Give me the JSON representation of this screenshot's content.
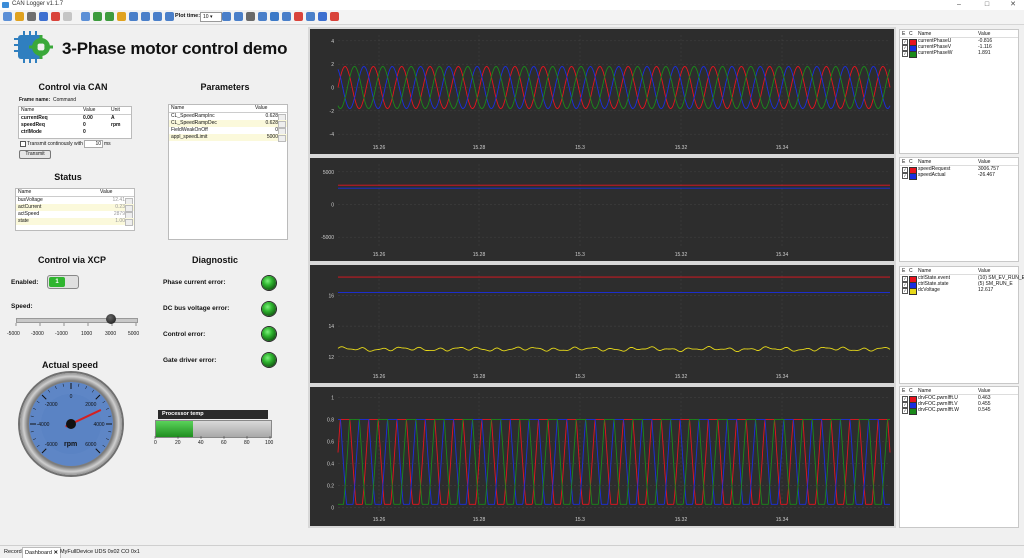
{
  "window": {
    "title": "CAN Logger v1.1.7",
    "minimize": "–",
    "maximize": "□",
    "close": "✕"
  },
  "toolbar": {
    "plot_time_label": "Plot time:",
    "plot_time_value": "10",
    "icons_group1": [
      "new-file-icon",
      "open-folder-icon",
      "open-icon",
      "save-icon",
      "stop-icon",
      "clear-icon"
    ],
    "icons_group2": [
      "grid-icon",
      "chart-icon",
      "trend-icon",
      "warning-icon",
      "zoom-in-icon",
      "zoom-out-icon",
      "zoom-fit-icon",
      "zoom-area-icon"
    ],
    "icons_group3": [
      "export-icon",
      "copy-icon",
      "print-icon",
      "filter-icon",
      "pen-icon",
      "measure-icon",
      "scale-icon",
      "info-icon",
      "close-circle-icon",
      "eject-icon"
    ]
  },
  "dashboard": {
    "title": "3-Phase motor control demo",
    "control_can": {
      "title": "Control via CAN",
      "frame_name_label": "Frame name:",
      "frame_name_value": "Command",
      "headers": [
        "Name",
        "Value",
        "Unit"
      ],
      "rows": [
        {
          "name": "currentReq",
          "value": "0.00",
          "unit": "A"
        },
        {
          "name": "speedReq",
          "value": "0",
          "unit": "rpm"
        },
        {
          "name": "ctrlMode",
          "value": "0",
          "unit": ""
        }
      ],
      "transmit_checkbox_label": "Transmit continously with",
      "transmit_period": "10",
      "transmit_unit": "ms",
      "transmit_button": "Transmit"
    },
    "parameters": {
      "title": "Parameters",
      "headers": [
        "Name",
        "Value"
      ],
      "rows": [
        {
          "name": "CL_SpeedRampInc",
          "value": "0.628"
        },
        {
          "name": "CL_SpeedRampDec",
          "value": "0.628"
        },
        {
          "name": "FieldWeakOnOff",
          "value": "0"
        },
        {
          "name": "appl_speedLimit",
          "value": "5000"
        }
      ]
    },
    "status": {
      "title": "Status",
      "headers": [
        "Name",
        "Value"
      ],
      "rows": [
        {
          "name": "busVoltage",
          "value": "12.41"
        },
        {
          "name": "actCurrent",
          "value": "0.23"
        },
        {
          "name": "actSpeed",
          "value": "2879"
        },
        {
          "name": "state",
          "value": "1.00"
        }
      ]
    },
    "control_xcp": {
      "title": "Control via XCP",
      "enabled_label": "Enabled:",
      "enabled_value": "1",
      "speed_label": "Speed:",
      "slider_value": 2879,
      "slider_min": -5000,
      "slider_max": 5000,
      "scale_labels": [
        "-5000",
        "-3000",
        "-1000",
        "1000",
        "3000",
        "5000"
      ]
    },
    "diagnostic": {
      "title": "Diagnostic",
      "items": [
        "Phase current error:",
        "DC bus voltage error:",
        "Control error:",
        "Gate driver error:"
      ]
    },
    "actual_speed": {
      "title": "Actual speed",
      "unit": "rpm",
      "value": 2879,
      "min": -6000,
      "max": 6000,
      "labels": [
        "-6000",
        "-4000",
        "-2000",
        "0",
        "2000",
        "4000",
        "6000"
      ]
    },
    "processor_temp": {
      "title": "Processor temp",
      "value": 32,
      "labels": [
        "0",
        "20",
        "40",
        "60",
        "80",
        "100"
      ]
    }
  },
  "plots": [
    {
      "x_ticks": [
        "15.26",
        "15.28",
        "15.3",
        "15.32",
        "15.34"
      ],
      "y_ticks": [
        "4",
        "2",
        "0",
        "-2",
        "-4"
      ],
      "legend_headers": [
        "E",
        "C",
        "Name",
        "Value"
      ],
      "signals": [
        {
          "name": "currentPhaseU",
          "value": "-0.816",
          "color": "#e8141e"
        },
        {
          "name": "currentPhaseV",
          "value": "-1.116",
          "color": "#1a2ee0"
        },
        {
          "name": "currentPhaseW",
          "value": "1.891",
          "color": "#1a8a1a"
        }
      ]
    },
    {
      "x_ticks": [
        "15.26",
        "15.28",
        "15.3",
        "15.32",
        "15.34"
      ],
      "y_ticks": [
        "5000",
        "0",
        "-5000"
      ],
      "legend_headers": [
        "E",
        "C",
        "Name",
        "Value"
      ],
      "signals": [
        {
          "name": "speedRequest",
          "value": "3006.757",
          "color": "#e8141e"
        },
        {
          "name": "speedActual",
          "value": "-26.467",
          "color": "#1a2ee0"
        }
      ]
    },
    {
      "x_ticks": [
        "15.26",
        "15.28",
        "15.3",
        "15.32",
        "15.34"
      ],
      "y_ticks": [
        "16",
        "14",
        "12"
      ],
      "legend_headers": [
        "E",
        "C",
        "Name",
        "Value"
      ],
      "signals": [
        {
          "name": "ctrlState.event",
          "value": "(10) SM_EV_RUN_E",
          "color": "#e8141e"
        },
        {
          "name": "ctrlState.state",
          "value": "(5) SM_RUN_E",
          "color": "#1a2ee0"
        },
        {
          "name": "dcVoltage",
          "value": "12.617",
          "color": "#e6d81a"
        }
      ]
    },
    {
      "x_ticks": [
        "15.26",
        "15.28",
        "15.3",
        "15.32",
        "15.34"
      ],
      "y_ticks": [
        "1",
        "0.8",
        "0.6",
        "0.4",
        "0.2",
        "0"
      ],
      "legend_headers": [
        "E",
        "C",
        "Name",
        "Value"
      ],
      "signals": [
        {
          "name": "drvFOC.pwmIfft.U",
          "value": "0.463",
          "color": "#e8141e"
        },
        {
          "name": "drvFOC.pwmIfft.V",
          "value": "0.455",
          "color": "#1a2ee0"
        },
        {
          "name": "drvFOC.pwmIfft.W",
          "value": "0.545",
          "color": "#1a8a1a"
        }
      ]
    }
  ],
  "bottom_tabs": [
    "Record",
    "Dashboard",
    "MyFullDevice UDS 0x02 CO 0x1"
  ],
  "colors": {
    "accent_green": "#2fb52f",
    "plot_bg": "#2d2d2d",
    "table_alt": "#fbf9db"
  }
}
